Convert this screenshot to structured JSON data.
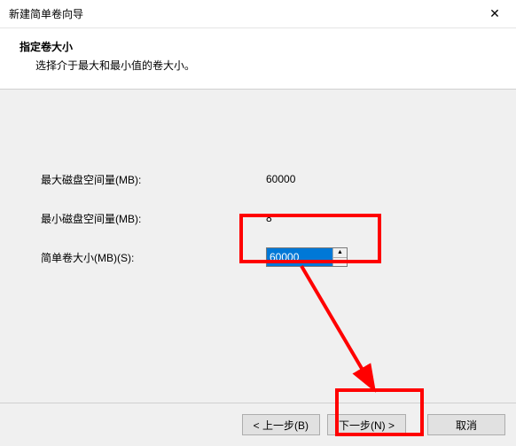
{
  "titlebar": {
    "title": "新建简单卷向导"
  },
  "header": {
    "title": "指定卷大小",
    "description": "选择介于最大和最小值的卷大小。"
  },
  "fields": {
    "max_label": "最大磁盘空间量(MB):",
    "max_value": "60000",
    "min_label": "最小磁盘空间量(MB):",
    "min_value": "8",
    "size_label": "简单卷大小(MB)(S):",
    "size_value": "60000"
  },
  "footer": {
    "back": "< 上一步(B)",
    "next": "下一步(N) >",
    "cancel": "取消"
  }
}
